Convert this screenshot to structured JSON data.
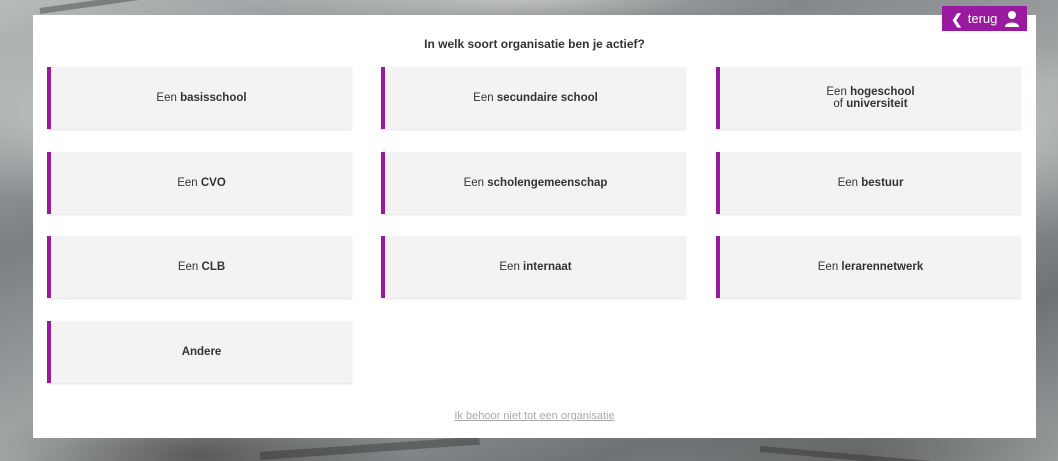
{
  "page": {
    "heading": "In welk soort organisatie ben je actief?",
    "back_label": "terug",
    "skip_link": "Ik behoor niet tot een organisatie"
  },
  "tiles": [
    {
      "prefix": "Een",
      "bold": "basisschool"
    },
    {
      "prefix": "Een",
      "bold": "secundaire school"
    },
    {
      "line1_prefix": "Een",
      "line1_bold": "hogeschool",
      "line2_prefix": "of",
      "line2_bold": "universiteit"
    },
    {
      "prefix": "Een",
      "bold": "CVO"
    },
    {
      "prefix": "Een",
      "bold": "scholengemeenschap"
    },
    {
      "prefix": "Een",
      "bold": "bestuur"
    },
    {
      "prefix": "Een",
      "bold": "CLB"
    },
    {
      "prefix": "Een",
      "bold": "internaat"
    },
    {
      "prefix": "Een",
      "bold": "lerarennetwerk"
    },
    {
      "prefix": "",
      "bold": "Andere"
    }
  ],
  "colors": {
    "accent": "#9a1a9f",
    "tile_bg": "#f3f3f3"
  },
  "icons": {
    "back": "chevron-left-icon",
    "user": "user-icon"
  }
}
